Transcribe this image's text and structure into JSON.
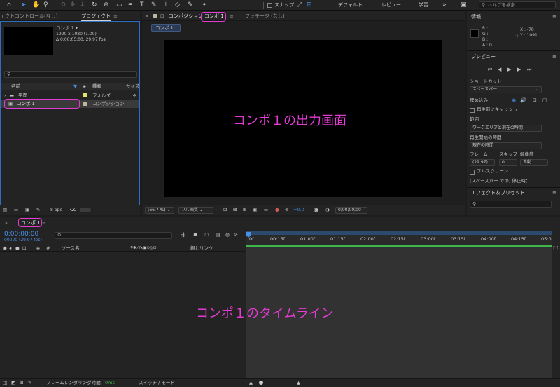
{
  "toolbar": {
    "snap_label": "スナップ",
    "workspaces": [
      "デフォルト",
      "レビュー",
      "学習"
    ],
    "help_placeholder": "ヘルプを検索"
  },
  "project_panel": {
    "tab_effect_controls": "ェクトコントロール(なし)",
    "tab_project": "プロジェクト",
    "item_name": "コンポ 1 ▾",
    "item_size": "1920 x 1080 (1.00)",
    "item_duration": "Δ 0;00;05;00, 29.97 fps",
    "columns": {
      "name": "名前",
      "type": "種類",
      "size": "サイズ"
    },
    "rows": [
      {
        "name": "平面",
        "type": "フォルダー",
        "color": "#e6e06a"
      },
      {
        "name": "コンポ 1",
        "type": "コンポジション",
        "color": "#bfb59e"
      }
    ],
    "bpc": "8 bpc"
  },
  "comp_viewer": {
    "tab_comp_prefix": "コンポジション",
    "tab_comp_name": "コンポ 1",
    "tab_footage": "フッテージ (なし)",
    "breadcrumb": "コンポ 1",
    "annotation": "コンポ１の出力画面",
    "zoom": "(66.7 %)",
    "resolution": "フル画質",
    "exposure": "+0.0",
    "timecode": "0;00;00;00"
  },
  "info_panel": {
    "title": "情報",
    "r": "R :",
    "g": "G :",
    "b": "B :",
    "a": "A : 0",
    "x": "X : -78",
    "y": "Y : 1091"
  },
  "preview_panel": {
    "title": "プレビュー",
    "shortcut_label": "ショートカット",
    "shortcut_value": "スペースバー",
    "include_label": "埋め込み：",
    "cache_label": "再生前にキャッシュ",
    "range_label": "範囲",
    "range_value": "ワークエリアと現在の時間",
    "play_from_label": "再生開始の時間",
    "play_from_value": "現在の時間",
    "frame_label": "フレーム",
    "skip_label": "スキップ",
    "res_label": "解像度",
    "frame_value": "(29.97)",
    "skip_value": "0",
    "res_value": "自動",
    "fullscreen_label": "フルスクリーン",
    "stop_note": "(スペースバー での) 停止時：",
    "effects_title": "エフェクト＆プリセット"
  },
  "timeline": {
    "tab_name": "コンポ 1",
    "timecode": "0;00;00;00",
    "frame_info": "00000 (29.97 fps)",
    "col_source": "ソース名",
    "col_parent": "親とリンク",
    "ruler": [
      "0f",
      "00:15f",
      "01:00f",
      "01:15f",
      "02:00f",
      "02:15f",
      "03:00f",
      "03:15f",
      "04:00f",
      "04:15f",
      "05:0"
    ],
    "annotation": "コンポ１のタイムライン",
    "render_time_label": "フレームレンダリング時間",
    "render_time_value": "0ms",
    "switch_mode": "スイッチ / モード"
  }
}
